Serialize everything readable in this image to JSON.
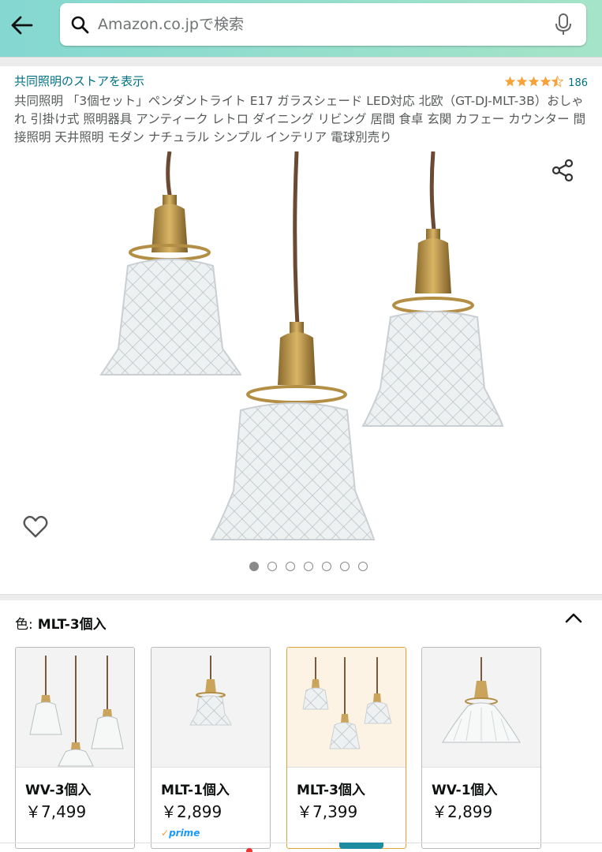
{
  "header": {
    "search_placeholder": "Amazon.co.jpで検索",
    "colors": {
      "gradient_start": "#84d8d1",
      "gradient_end": "#a5e4c8"
    }
  },
  "product": {
    "store_link": "共同照明のストアを表示",
    "rating_stars": 4.5,
    "rating_count": "186",
    "title": "共同照明 「3個セット」ペンダントライト E17 ガラスシェード LED対応 北欧（GT-DJ-MLT-3B）おしゃれ 引掛け式 照明器具 アンティーク レトロ ダイニング リビング 居間 食卓 玄関 カフェー カウンター 間接照明 天井照明 モダン ナチュラル シンプル インテリア 電球別売り",
    "image_count": 7,
    "active_image_index": 0
  },
  "color_selector": {
    "label": "色:",
    "selected_value": "MLT-3個入",
    "variants": [
      {
        "name": "WV-3個入",
        "price": "￥7,499",
        "prime": "",
        "selected": false
      },
      {
        "name": "MLT-1個入",
        "price": "￥2,899",
        "prime": "prime",
        "selected": false
      },
      {
        "name": "MLT-3個入",
        "price": "￥7,399",
        "prime": "",
        "selected": true
      },
      {
        "name": "WV-1個入",
        "price": "￥2,899",
        "prime": "",
        "selected": false
      }
    ]
  },
  "accent_colors": {
    "link": "#007185",
    "star": "#f7a23b",
    "selected_border": "#e3a33a"
  }
}
